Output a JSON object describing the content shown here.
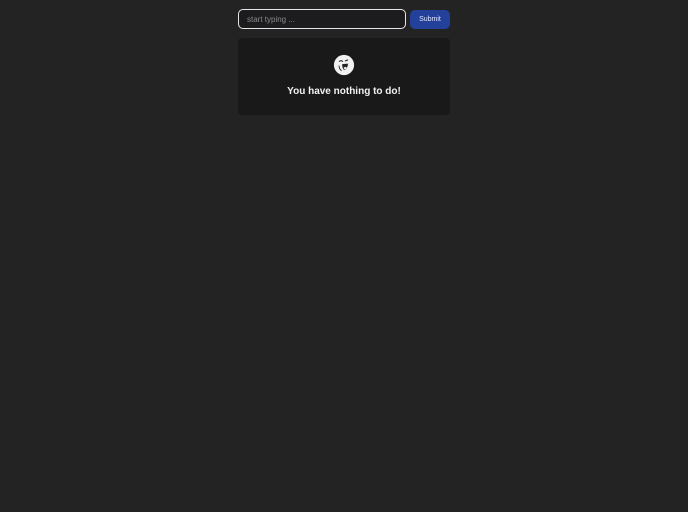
{
  "todo": {
    "input": {
      "value": "",
      "placeholder": "start typing ..."
    },
    "submit_label": "Submit",
    "empty_state": {
      "icon": "laughing-face-icon",
      "message": "You have nothing to do!"
    }
  },
  "colors": {
    "background": "#232323",
    "panel": "#19191a",
    "accent": "#23409a"
  }
}
